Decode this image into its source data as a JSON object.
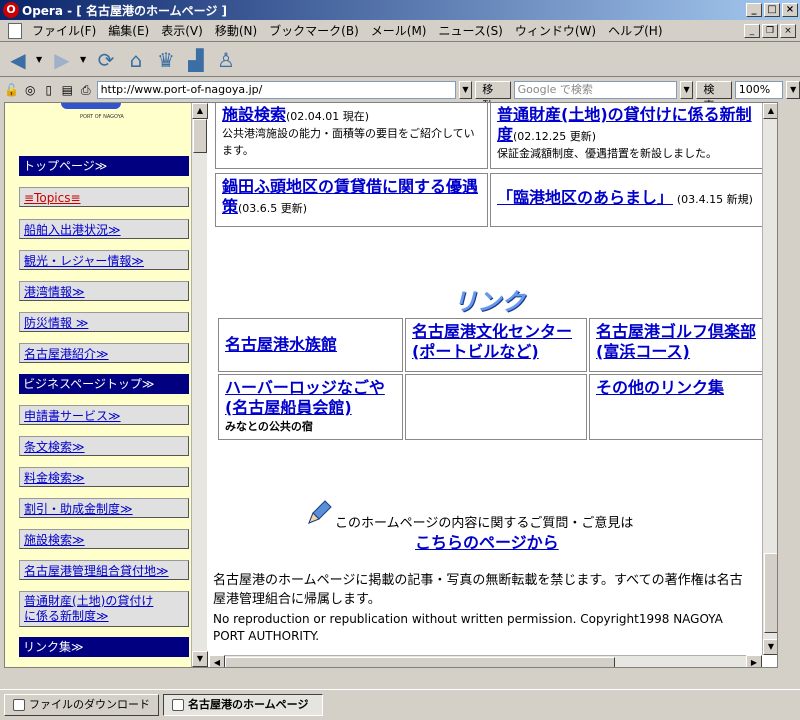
{
  "window": {
    "title": "Opera - [ 名古屋港のホームページ ]"
  },
  "menubar": {
    "items": [
      "ファイル(F)",
      "編集(E)",
      "表示(V)",
      "移動(N)",
      "ブックマーク(B)",
      "メール(M)",
      "ニュース(S)",
      "ウィンドウ(W)",
      "ヘルプ(H)"
    ]
  },
  "addressbar": {
    "url": "http://www.port-of-nagoya.jp/",
    "go_label": "移動",
    "search_placeholder": "Google で検索",
    "search_label": "検索",
    "zoom": "100%"
  },
  "sidebar": {
    "logo_caption": "PORT OF NAGOYA",
    "items": [
      {
        "label": "トップページ≫",
        "kind": "head"
      },
      {
        "label": "≡Topics≡",
        "kind": "topics"
      },
      {
        "label": "船舶入出港状況≫",
        "kind": "link"
      },
      {
        "label": "観光・レジャー情報≫",
        "kind": "link"
      },
      {
        "label": "港湾情報≫",
        "kind": "link"
      },
      {
        "label": "防災情報 ≫",
        "kind": "link"
      },
      {
        "label": "名古屋港紹介≫",
        "kind": "link"
      },
      {
        "label": "ビジネスページトップ≫",
        "kind": "head"
      },
      {
        "label": "申請書サービス≫",
        "kind": "link"
      },
      {
        "label": "条文検索≫",
        "kind": "link"
      },
      {
        "label": "料金検索≫",
        "kind": "link"
      },
      {
        "label": "割引・助成金制度≫",
        "kind": "link"
      },
      {
        "label": "施設検索≫",
        "kind": "link"
      },
      {
        "label": "名古屋港管理組合貸付地≫",
        "kind": "link"
      },
      {
        "label": "普通財産(土地)の貸付け",
        "label2": "に係る新制度≫",
        "kind": "link"
      },
      {
        "label": "リンク集≫",
        "kind": "head"
      }
    ]
  },
  "news": {
    "cells": [
      {
        "title": "施設検索",
        "note": "(02.04.01 現在)",
        "desc": "公共港湾施設の能力・面積等の要目をご紹介しています。"
      },
      {
        "title": "普通財産(土地)の貸付けに係る新制度",
        "note": "(02.12.25 更新)",
        "desc": "保証金減額制度、優遇措置を新設しました。"
      },
      {
        "title": "鍋田ふ頭地区の賃貸借に関する優遇策",
        "note": "(03.6.5 更新)",
        "desc": ""
      },
      {
        "title": "「臨港地区のあらまし」",
        "note": "(03.4.15 新規)",
        "desc": ""
      }
    ]
  },
  "links": {
    "heading": "リンク集",
    "cells": [
      {
        "label": "名古屋港水族館",
        "sub": ""
      },
      {
        "label": "名古屋港文化センター(ポートビルなど)",
        "sub": ""
      },
      {
        "label": "名古屋港ゴルフ倶楽部(富浜コース)",
        "sub": ""
      },
      {
        "label": "ハーバーロッジなごや(名古屋船員会館)",
        "sub": "みなとの公共の宿"
      },
      {
        "label": "",
        "sub": ""
      },
      {
        "label": "その他のリンク集",
        "sub": ""
      }
    ]
  },
  "contact": {
    "text": "このホームページの内容に関するご質問・ご意見は",
    "link": "こちらのページから"
  },
  "footer": {
    "jp": "名古屋港のホームページに掲載の記事・写真の無断転載を禁じます。すべての著作権は名古屋港管理組合に帰属します。",
    "en": "No reproduction or republication without written permission. Copyright1998 NAGOYA PORT AUTHORITY."
  },
  "taskbar": {
    "tabs": [
      "ファイルのダウンロード",
      "名古屋港のホームページ"
    ]
  }
}
